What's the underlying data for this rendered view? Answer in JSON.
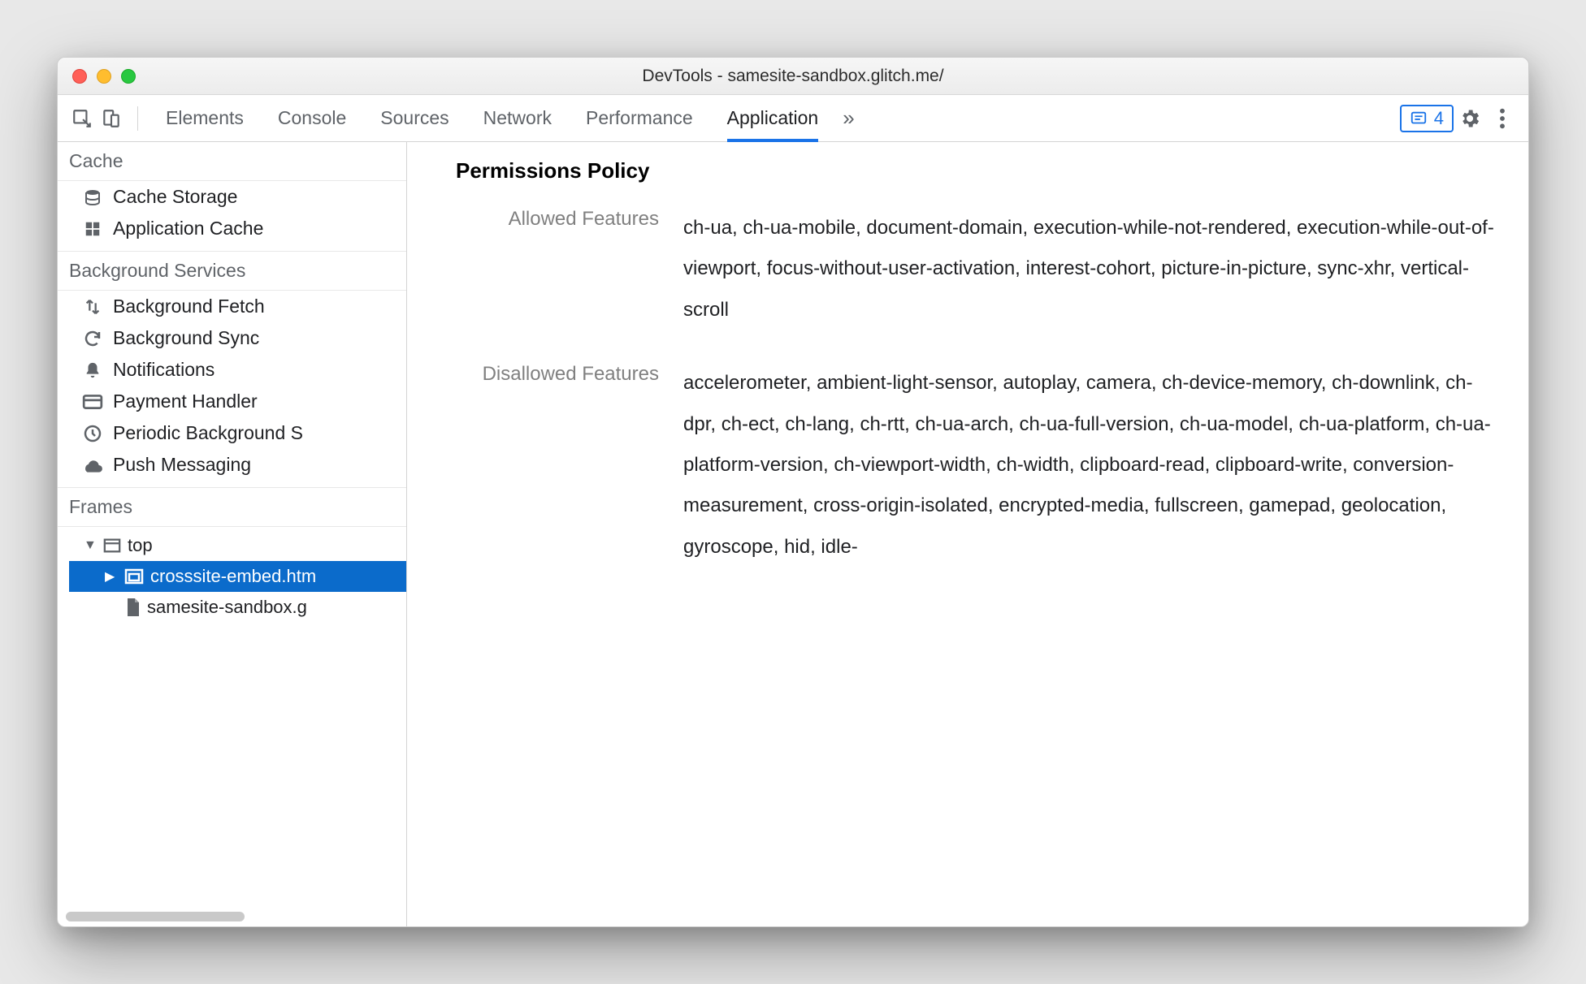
{
  "window": {
    "title": "DevTools - samesite-sandbox.glitch.me/"
  },
  "tabs": {
    "items": [
      "Elements",
      "Console",
      "Sources",
      "Network",
      "Performance",
      "Application"
    ],
    "active": 5,
    "overflow_glyph": "»"
  },
  "issues_badge": {
    "count": "4"
  },
  "sidebar": {
    "sections": [
      {
        "title": "Cache",
        "items": [
          {
            "icon": "stack-icon",
            "label": "Cache Storage"
          },
          {
            "icon": "grid-icon",
            "label": "Application Cache"
          }
        ]
      },
      {
        "title": "Background Services",
        "items": [
          {
            "icon": "transfer-icon",
            "label": "Background Fetch"
          },
          {
            "icon": "sync-icon",
            "label": "Background Sync"
          },
          {
            "icon": "bell-icon",
            "label": "Notifications"
          },
          {
            "icon": "card-icon",
            "label": "Payment Handler"
          },
          {
            "icon": "clock-icon",
            "label": "Periodic Background S"
          },
          {
            "icon": "cloud-icon",
            "label": "Push Messaging"
          }
        ]
      },
      {
        "title": "Frames",
        "tree": [
          {
            "level": 1,
            "arrow": "▼",
            "icon": "window-icon",
            "label": "top",
            "selected": false
          },
          {
            "level": 2,
            "arrow": "▶",
            "icon": "embed-icon",
            "label": "crosssite-embed.htm",
            "selected": true
          },
          {
            "level": 3,
            "arrow": "",
            "icon": "file-icon",
            "label": "samesite-sandbox.g",
            "selected": false
          }
        ]
      }
    ]
  },
  "main": {
    "heading": "Permissions Policy",
    "rows": [
      {
        "label": "Allowed Features",
        "value": "ch-ua, ch-ua-mobile, document-domain, execution-while-not-rendered, execution-while-out-of-viewport, focus-without-user-activation, interest-cohort, picture-in-picture, sync-xhr, vertical-scroll"
      },
      {
        "label": "Disallowed Features",
        "value": "accelerometer, ambient-light-sensor, autoplay, camera, ch-device-memory, ch-downlink, ch-dpr, ch-ect, ch-lang, ch-rtt, ch-ua-arch, ch-ua-full-version, ch-ua-model, ch-ua-platform, ch-ua-platform-version, ch-viewport-width, ch-width, clipboard-read, clipboard-write, conversion-measurement, cross-origin-isolated, encrypted-media, fullscreen, gamepad, geolocation, gyroscope, hid, idle-"
      }
    ]
  }
}
